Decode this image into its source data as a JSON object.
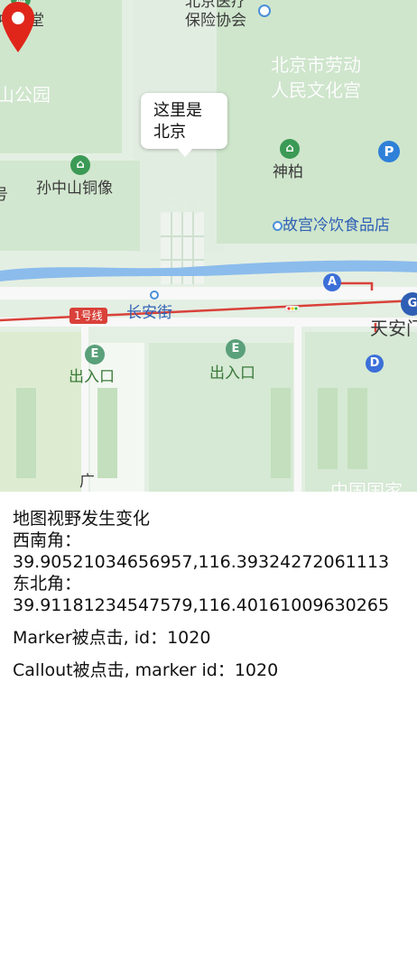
{
  "map": {
    "labels": {
      "top_hospital": "北京医疗",
      "insurance": "保险协会",
      "zhongshantang": "中山堂",
      "park": "山公园",
      "labor_palace_1": "北京市劳动",
      "labor_palace_2": "人民文化宫",
      "shenbai": "神柏",
      "sun_statue": "孙中山铜像",
      "left_edge": "号",
      "tiananmen_faded": "天安门",
      "food_store": "故宫冷饮食品店",
      "line1": "1号线",
      "changan": "长安街",
      "tiananmen_right": "天安门",
      "entrance_left": "出入口",
      "entrance_right": "出入口",
      "bottom_guang": "广",
      "bottom_right": "中国国家"
    },
    "icons": {
      "parking": "P",
      "metro_a": "A",
      "metro_d": "D",
      "metro_right": "G",
      "entrance_icon": "E"
    },
    "callout_text": "这里是\n北京",
    "colors": {
      "marker": "#e0261b",
      "road": "#d9413a",
      "water": "#8bbcec",
      "green": "#cfe6cc"
    }
  },
  "log": {
    "line1": "地图视野发生变化",
    "line2": "西南角：",
    "line3": "39.90521034656957,116.39324272061113",
    "line4": "东北角：",
    "line5": "39.91181234547579,116.40161009630265",
    "line6": "Marker被点击, id：1020",
    "line7": "Callout被点击, marker id：1020"
  }
}
